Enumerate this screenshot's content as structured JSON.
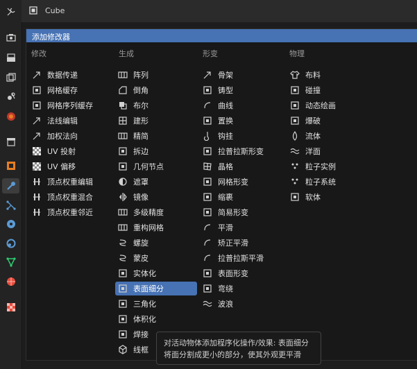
{
  "header": {
    "object_name": "Cube"
  },
  "sidebar": {
    "icons": [
      "tool-icon",
      "render-icon",
      "output-icon",
      "view-layer-icon",
      "scene-icon",
      "world-icon",
      "collection-icon",
      "object-icon",
      "modifier-icon",
      "particles-icon",
      "physics-icon",
      "constraints-icon",
      "data-icon",
      "material-icon",
      "texture-icon"
    ]
  },
  "panel": {
    "title": "添加修改器",
    "columns": [
      {
        "heading": "修改",
        "items": [
          "数据传递",
          "网格缓存",
          "网格序列缓存",
          "法线编辑",
          "加权法向",
          "UV 投射",
          "UV 偏移",
          "顶点权重编辑",
          "顶点权重混合",
          "顶点权重邻近"
        ]
      },
      {
        "heading": "生成",
        "items": [
          "阵列",
          "倒角",
          "布尔",
          "建形",
          "精简",
          "拆边",
          "几何节点",
          "遮罩",
          "镜像",
          "多级精度",
          "重构网格",
          "螺旋",
          "蒙皮",
          "实体化",
          "表面细分",
          "三角化",
          "体积化",
          "焊接",
          "线框"
        ]
      },
      {
        "heading": "形变",
        "items": [
          "骨架",
          "铸型",
          "曲线",
          "置换",
          "钩挂",
          "拉普拉斯形变",
          "晶格",
          "网格形变",
          "缩裹",
          "简易形变",
          "平滑",
          "矫正平滑",
          "拉普拉斯平滑",
          "表面形变",
          "弯绕",
          "波浪"
        ]
      },
      {
        "heading": "物理",
        "items": [
          "布料",
          "碰撞",
          "动态绘画",
          "爆破",
          "流体",
          "洋面",
          "粒子实例",
          "粒子系统",
          "软体"
        ]
      }
    ],
    "highlighted": "表面细分"
  },
  "tooltip": {
    "line1": "对活动物体添加程序化操作/效果: 表面细分",
    "line2": "将面分割成更小的部分，使其外观更平滑"
  },
  "colors": {
    "accent": "#4772b3",
    "panel_bg": "#181818",
    "header_bg": "#2b2b2b"
  }
}
